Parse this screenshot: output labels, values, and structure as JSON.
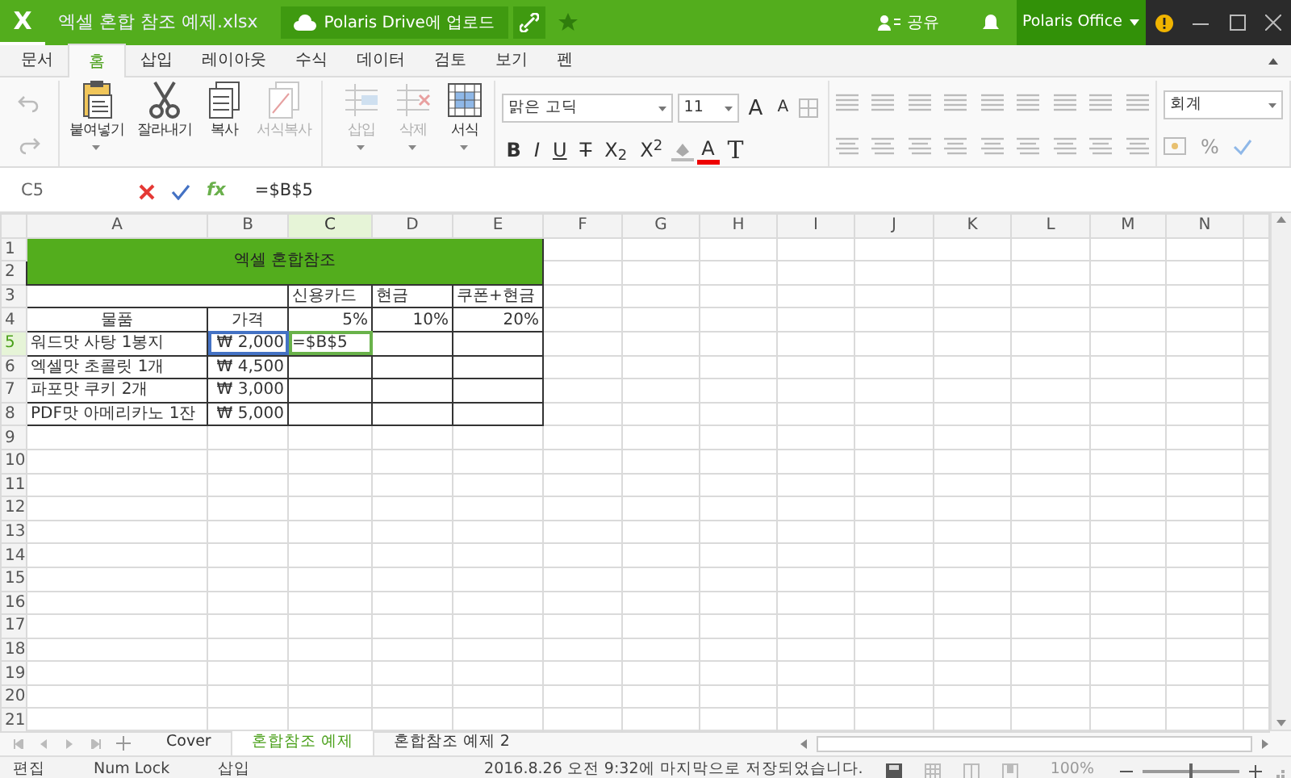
{
  "title_bar": {
    "logo": "X",
    "file_name": "엑셀 혼합 참조 예제.xlsx",
    "upload_button": "Polaris Drive에 업로드",
    "share": "공유",
    "account": "Polaris Office"
  },
  "menu_tabs": [
    {
      "label": "문서",
      "selected": false
    },
    {
      "label": "홈",
      "selected": true
    },
    {
      "label": "삽입",
      "selected": false
    },
    {
      "label": "레이아웃",
      "selected": false
    },
    {
      "label": "수식",
      "selected": false
    },
    {
      "label": "데이터",
      "selected": false
    },
    {
      "label": "검토",
      "selected": false
    },
    {
      "label": "보기",
      "selected": false
    },
    {
      "label": "펜",
      "selected": false
    }
  ],
  "ribbon": {
    "history": [
      {
        "kind": "undo",
        "disabled": true
      },
      {
        "kind": "redo",
        "disabled": true
      }
    ],
    "clipboard": [
      {
        "kind": "paste",
        "label": "붙여넣기",
        "disabled": false,
        "dropdown": true
      },
      {
        "kind": "cut",
        "label": "잘라내기",
        "disabled": false,
        "dropdown": false
      },
      {
        "kind": "copy",
        "label": "복사",
        "disabled": false,
        "dropdown": false
      },
      {
        "kind": "painter",
        "label": "서식복사",
        "disabled": true,
        "dropdown": false
      }
    ],
    "cells": [
      {
        "kind": "insert",
        "label": "삽입",
        "disabled": true,
        "dropdown": true
      },
      {
        "kind": "delete",
        "label": "삭제",
        "disabled": true,
        "dropdown": true
      },
      {
        "kind": "format",
        "label": "서식",
        "disabled": false,
        "dropdown": true
      }
    ],
    "font": {
      "name": "맑은 고딕",
      "size": "11",
      "grow": "A",
      "shrink": "A"
    },
    "format_buttons": [
      {
        "kind": "bold",
        "text": "B"
      },
      {
        "kind": "italic",
        "text": "I"
      },
      {
        "kind": "underline",
        "text": "U"
      },
      {
        "kind": "strike",
        "text": "T"
      },
      {
        "kind": "sub",
        "text": "X$_{2}$"
      },
      {
        "kind": "sup",
        "text": "X$^{2}$"
      },
      {
        "kind": "fill"
      },
      {
        "kind": "color",
        "text": "A"
      },
      {
        "kind": "clear",
        "text": "T"
      }
    ],
    "number_format": "회계",
    "percent": "%"
  },
  "formula_bar": {
    "cell": "C5",
    "fx": "fx",
    "formula": "=$B$5"
  },
  "columns": [
    {
      "label": "A",
      "selected": false
    },
    {
      "label": "B",
      "selected": false
    },
    {
      "label": "C",
      "selected": true
    },
    {
      "label": "D",
      "selected": false
    },
    {
      "label": "E",
      "selected": false
    },
    {
      "label": "F",
      "selected": false
    },
    {
      "label": "G",
      "selected": false
    },
    {
      "label": "H",
      "selected": false
    },
    {
      "label": "I",
      "selected": false
    },
    {
      "label": "J",
      "selected": false
    },
    {
      "label": "K",
      "selected": false
    },
    {
      "label": "L",
      "selected": false
    },
    {
      "label": "M",
      "selected": false
    },
    {
      "label": "N",
      "selected": false
    }
  ],
  "title_cell": "엑셀 혼합참조",
  "rows": [
    {
      "header": "1",
      "selected": false,
      "kind": "title"
    },
    {
      "header": "2",
      "selected": false,
      "kind": "title_cont"
    },
    {
      "header": "3",
      "selected": false,
      "kind": "sub",
      "cells": [
        null,
        null,
        {
          "text": "신용카드"
        },
        {
          "text": "현금"
        },
        {
          "text": "쿠폰+현금"
        }
      ]
    },
    {
      "header": "4",
      "selected": false,
      "kind": "head",
      "cells": [
        {
          "text": "물품"
        },
        {
          "text": "가격"
        },
        {
          "text": "5%"
        },
        {
          "text": "10%"
        },
        {
          "text": "20%"
        }
      ]
    },
    {
      "header": "5",
      "selected": true,
      "kind": "item",
      "cells": [
        {
          "text": "워드맛 사탕 1봉지"
        },
        {
          "text": "₩ 2,000",
          "referenced": true
        },
        {
          "text": "=$B$5",
          "active": true
        },
        null,
        null
      ]
    },
    {
      "header": "6",
      "selected": false,
      "kind": "item",
      "cells": [
        {
          "text": "엑셀맛 초콜릿 1개"
        },
        {
          "text": "₩ 4,500"
        },
        null,
        null,
        null
      ]
    },
    {
      "header": "7",
      "selected": false,
      "kind": "item",
      "cells": [
        {
          "text": "파포맛 쿠키 2개"
        },
        {
          "text": "₩ 3,000"
        },
        null,
        null,
        null
      ]
    },
    {
      "header": "8",
      "selected": false,
      "kind": "item",
      "cells": [
        {
          "text": "PDF맛 아메리카노 1잔"
        },
        {
          "text": "₩ 5,000"
        },
        null,
        null,
        null
      ]
    },
    {
      "header": "9",
      "selected": false,
      "kind": "blank"
    },
    {
      "header": "10",
      "selected": false,
      "kind": "blank"
    },
    {
      "header": "11",
      "selected": false,
      "kind": "blank"
    },
    {
      "header": "12",
      "selected": false,
      "kind": "blank"
    },
    {
      "header": "13",
      "selected": false,
      "kind": "blank"
    },
    {
      "header": "14",
      "selected": false,
      "kind": "blank"
    },
    {
      "header": "15",
      "selected": false,
      "kind": "blank"
    },
    {
      "header": "16",
      "selected": false,
      "kind": "blank"
    },
    {
      "header": "17",
      "selected": false,
      "kind": "blank"
    },
    {
      "header": "18",
      "selected": false,
      "kind": "blank"
    },
    {
      "header": "19",
      "selected": false,
      "kind": "blank"
    },
    {
      "header": "20",
      "selected": false,
      "kind": "blank"
    },
    {
      "header": "21",
      "selected": false,
      "kind": "blank"
    }
  ],
  "sheet_tabs": [
    {
      "label": "Cover",
      "selected": false
    },
    {
      "label": "혼합참조 예제",
      "selected": true
    },
    {
      "label": "혼합참조 예제 2",
      "selected": false
    }
  ],
  "status_bar": {
    "items": [
      "편집",
      "Num Lock",
      "삽입"
    ],
    "message": "2016.8.26 오전 9:32에 마지막으로 저장되었습니다.",
    "zoom": "100%",
    "zoom_slider": {
      "level": 0.5
    }
  }
}
